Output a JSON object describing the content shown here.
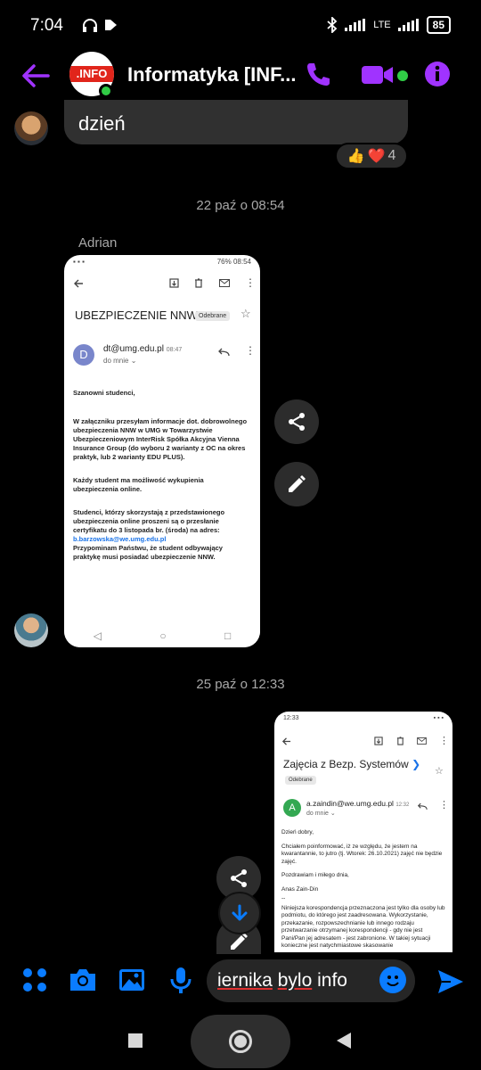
{
  "status_bar": {
    "time": "7:04",
    "network": "LTE",
    "battery": "85"
  },
  "header": {
    "avatar_label": ".INFO",
    "title": "Informatyka [INF..."
  },
  "colors": {
    "accent": "#a033ff",
    "online": "#31cc46",
    "messenger_blue": "#0a7cff"
  },
  "messages": {
    "first": {
      "text": "dzień",
      "reaction_count": "4",
      "reactions": [
        "👍",
        "❤️"
      ]
    },
    "timestamp_1": "22 paź o 08:54",
    "sender_name": "Adrian",
    "timestamp_2": "25 paź o 12:33"
  },
  "screenshot_1": {
    "status": "76%  08:54",
    "subject": "UBEZPIECZENIE NNW.",
    "label": "Odebrane",
    "sender_initial": "D",
    "from": "dt@umg.edu.pl",
    "time": "08:47",
    "to": "do mnie",
    "greeting": "Szanowni studenci,",
    "para1": "W załączniku przesyłam informacje dot. dobrowolnego ubezpieczenia NNW w UMG w Towarzystwie Ubezpieczeniowym InterRisk Spółka Akcyjna Vienna Insurance Group (do wyboru 2 warianty z OC na okres praktyk, lub 2 warianty EDU PLUS).",
    "para2": "Każdy student ma możliwość wykupienia ubezpieczenia online.",
    "para3": "Studenci, którzy skorzystają z przedstawionego ubezpieczenia online proszeni są o przesłanie certyfikatu do 3 listopada br. (środa) na adres:",
    "email_link": "b.barzowska@we.umg.edu.pl",
    "para4": "Przypominam Państwu, że student odbywający praktykę musi posiadać ubezpieczenie NNW."
  },
  "screenshot_2": {
    "status": "12:33",
    "subject": "Zajęcia z Bezp. Systemów",
    "label": "Odebrane",
    "sender_initial": "A",
    "from": "a.zaindin@we.umg.edu.pl",
    "time": "12:32",
    "to": "do mnie",
    "greeting": "Dzień dobry,",
    "para1": "Chciałem poinformować, iż ze względu, że jestem na kwarantannie, to jutro (tj. Wtorek: 26.10.2021) zajęć nie będzie zajęć.",
    "para2": "Pozdrawiam i miłego dnia,",
    "para3": "Anas Zain-Din",
    "para4": "Niniejsza korespondencja przeznaczona jest tylko dla osoby lub podmiotu, do którego jest zaadresowana. Wykorzystanie, przekazanie, rozpowszechnianie lub innego rodzaju przetwarzanie otrzymanej korespondencji - gdy nie jest Pani/Pan jej adresatem - jest zabronione. W takiej sytuacji konieczne jest natychmiastowe skasowanie"
  },
  "composer": {
    "text_underlined": "iernika",
    "text_plain": "bylo",
    "text_tail": "info"
  }
}
